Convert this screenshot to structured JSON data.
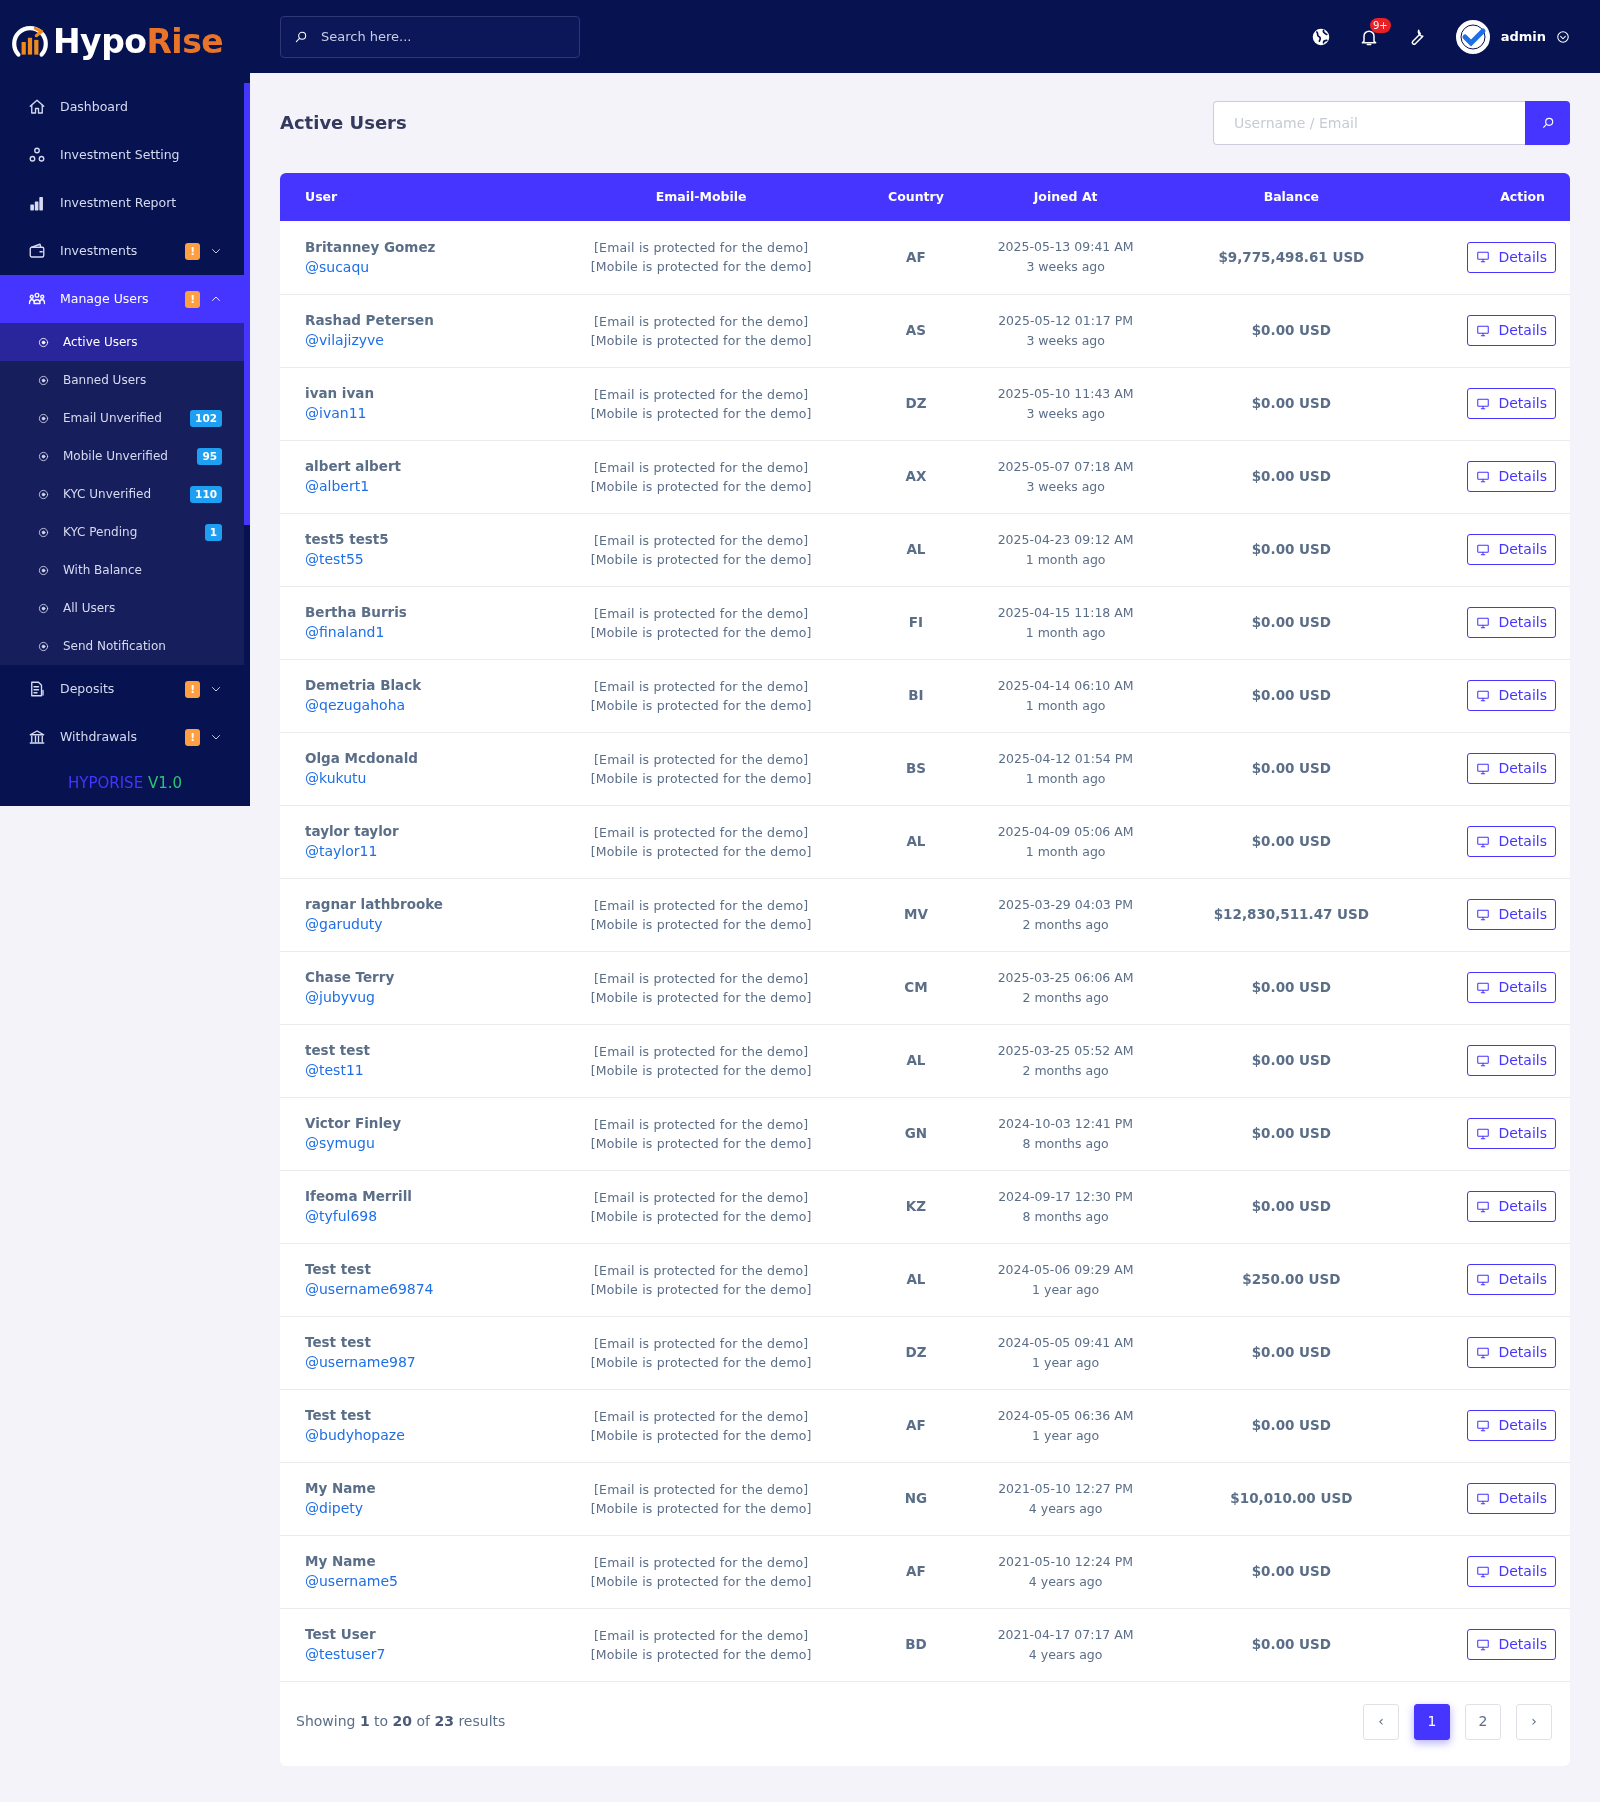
{
  "logo": {
    "part_1": "Hypo",
    "part_2": "Rise"
  },
  "sidebar": {
    "items": [
      {
        "label": "Dashboard",
        "selected": false
      },
      {
        "label": "Investment Setting",
        "selected": false
      },
      {
        "label": "Investment Report",
        "selected": false
      },
      {
        "label": "Investments",
        "selected": false,
        "expanded": false,
        "badge": {
          "text": "!",
          "color": "#ff9f43"
        }
      },
      {
        "label": "Manage Users",
        "selected": true,
        "expanded": true,
        "badge": {
          "text": "!",
          "color": "#ff9f43"
        },
        "children": [
          {
            "label": "Active Users",
            "selected": true
          },
          {
            "label": "Banned Users",
            "selected": false
          },
          {
            "label": "Email Unverified",
            "selected": false,
            "badge": {
              "text": "102",
              "color": "#1e9ff2"
            }
          },
          {
            "label": "Mobile Unverified",
            "selected": false,
            "badge": {
              "text": "95",
              "color": "#1e9ff2"
            }
          },
          {
            "label": "KYC Unverified",
            "selected": false,
            "badge": {
              "text": "110",
              "color": "#1e9ff2"
            }
          },
          {
            "label": "KYC Pending",
            "selected": false,
            "badge": {
              "text": "1",
              "color": "#1e9ff2"
            }
          },
          {
            "label": "With Balance",
            "selected": false
          },
          {
            "label": "All Users",
            "selected": false
          },
          {
            "label": "Send Notification",
            "selected": false
          }
        ]
      },
      {
        "label": "Deposits",
        "selected": false,
        "expanded": false,
        "badge": {
          "text": "!",
          "color": "#ff9f43"
        }
      },
      {
        "label": "Withdrawals",
        "selected": false,
        "expanded": false,
        "badge": {
          "text": "!",
          "color": "#ff9f43"
        }
      }
    ],
    "version": {
      "name": "HYPORISE",
      "number": "V1.0"
    }
  },
  "header": {
    "search": {
      "placeholder": "Search here..."
    },
    "notification_count": "9+",
    "user": "admin"
  },
  "page": {
    "title": "Active Users",
    "search": {
      "placeholder": "Username / Email"
    }
  },
  "table": {
    "columns": [
      "User",
      "Email-Mobile",
      "Country",
      "Joined At",
      "Balance",
      "Action"
    ],
    "rows": [
      {
        "name": "Britanney Gomez",
        "username": "@sucaqu",
        "email": "[Email is protected for the demo]",
        "mobile": "[Mobile is protected for the demo]",
        "country": "AF",
        "joined": "2025-05-13 09:41 AM",
        "joined_ago": "3 weeks ago",
        "balance": "$9,775,498.61 USD",
        "action": "Details"
      },
      {
        "name": "Rashad Petersen",
        "username": "@vilajizyve",
        "email": "[Email is protected for the demo]",
        "mobile": "[Mobile is protected for the demo]",
        "country": "AS",
        "joined": "2025-05-12 01:17 PM",
        "joined_ago": "3 weeks ago",
        "balance": "$0.00 USD",
        "action": "Details"
      },
      {
        "name": "ivan ivan",
        "username": "@ivan11",
        "email": "[Email is protected for the demo]",
        "mobile": "[Mobile is protected for the demo]",
        "country": "DZ",
        "joined": "2025-05-10 11:43 AM",
        "joined_ago": "3 weeks ago",
        "balance": "$0.00 USD",
        "action": "Details"
      },
      {
        "name": "albert albert",
        "username": "@albert1",
        "email": "[Email is protected for the demo]",
        "mobile": "[Mobile is protected for the demo]",
        "country": "AX",
        "joined": "2025-05-07 07:18 AM",
        "joined_ago": "3 weeks ago",
        "balance": "$0.00 USD",
        "action": "Details"
      },
      {
        "name": "test5 test5",
        "username": "@test55",
        "email": "[Email is protected for the demo]",
        "mobile": "[Mobile is protected for the demo]",
        "country": "AL",
        "joined": "2025-04-23 09:12 AM",
        "joined_ago": "1 month ago",
        "balance": "$0.00 USD",
        "action": "Details"
      },
      {
        "name": "Bertha Burris",
        "username": "@finaland1",
        "email": "[Email is protected for the demo]",
        "mobile": "[Mobile is protected for the demo]",
        "country": "FI",
        "joined": "2025-04-15 11:18 AM",
        "joined_ago": "1 month ago",
        "balance": "$0.00 USD",
        "action": "Details"
      },
      {
        "name": "Demetria Black",
        "username": "@qezugahoha",
        "email": "[Email is protected for the demo]",
        "mobile": "[Mobile is protected for the demo]",
        "country": "BI",
        "joined": "2025-04-14 06:10 AM",
        "joined_ago": "1 month ago",
        "balance": "$0.00 USD",
        "action": "Details"
      },
      {
        "name": "Olga Mcdonald",
        "username": "@kukutu",
        "email": "[Email is protected for the demo]",
        "mobile": "[Mobile is protected for the demo]",
        "country": "BS",
        "joined": "2025-04-12 01:54 PM",
        "joined_ago": "1 month ago",
        "balance": "$0.00 USD",
        "action": "Details"
      },
      {
        "name": "taylor taylor",
        "username": "@taylor11",
        "email": "[Email is protected for the demo]",
        "mobile": "[Mobile is protected for the demo]",
        "country": "AL",
        "joined": "2025-04-09 05:06 AM",
        "joined_ago": "1 month ago",
        "balance": "$0.00 USD",
        "action": "Details"
      },
      {
        "name": "ragnar lathbrooke",
        "username": "@garuduty",
        "email": "[Email is protected for the demo]",
        "mobile": "[Mobile is protected for the demo]",
        "country": "MV",
        "joined": "2025-03-29 04:03 PM",
        "joined_ago": "2 months ago",
        "balance": "$12,830,511.47 USD",
        "action": "Details"
      },
      {
        "name": "Chase Terry",
        "username": "@jubyvug",
        "email": "[Email is protected for the demo]",
        "mobile": "[Mobile is protected for the demo]",
        "country": "CM",
        "joined": "2025-03-25 06:06 AM",
        "joined_ago": "2 months ago",
        "balance": "$0.00 USD",
        "action": "Details"
      },
      {
        "name": "test test",
        "username": "@test11",
        "email": "[Email is protected for the demo]",
        "mobile": "[Mobile is protected for the demo]",
        "country": "AL",
        "joined": "2025-03-25 05:52 AM",
        "joined_ago": "2 months ago",
        "balance": "$0.00 USD",
        "action": "Details"
      },
      {
        "name": "Victor Finley",
        "username": "@symugu",
        "email": "[Email is protected for the demo]",
        "mobile": "[Mobile is protected for the demo]",
        "country": "GN",
        "joined": "2024-10-03 12:41 PM",
        "joined_ago": "8 months ago",
        "balance": "$0.00 USD",
        "action": "Details"
      },
      {
        "name": "Ifeoma Merrill",
        "username": "@tyful698",
        "email": "[Email is protected for the demo]",
        "mobile": "[Mobile is protected for the demo]",
        "country": "KZ",
        "joined": "2024-09-17 12:30 PM",
        "joined_ago": "8 months ago",
        "balance": "$0.00 USD",
        "action": "Details"
      },
      {
        "name": "Test test",
        "username": "@username69874",
        "email": "[Email is protected for the demo]",
        "mobile": "[Mobile is protected for the demo]",
        "country": "AL",
        "joined": "2024-05-06 09:29 AM",
        "joined_ago": "1 year ago",
        "balance": "$250.00 USD",
        "action": "Details"
      },
      {
        "name": "Test test",
        "username": "@username987",
        "email": "[Email is protected for the demo]",
        "mobile": "[Mobile is protected for the demo]",
        "country": "DZ",
        "joined": "2024-05-05 09:41 AM",
        "joined_ago": "1 year ago",
        "balance": "$0.00 USD",
        "action": "Details"
      },
      {
        "name": "Test test",
        "username": "@budyhopaze",
        "email": "[Email is protected for the demo]",
        "mobile": "[Mobile is protected for the demo]",
        "country": "AF",
        "joined": "2024-05-05 06:36 AM",
        "joined_ago": "1 year ago",
        "balance": "$0.00 USD",
        "action": "Details"
      },
      {
        "name": "My Name",
        "username": "@dipety",
        "email": "[Email is protected for the demo]",
        "mobile": "[Mobile is protected for the demo]",
        "country": "NG",
        "joined": "2021-05-10 12:27 PM",
        "joined_ago": "4 years ago",
        "balance": "$10,010.00 USD",
        "action": "Details"
      },
      {
        "name": "My Name",
        "username": "@username5",
        "email": "[Email is protected for the demo]",
        "mobile": "[Mobile is protected for the demo]",
        "country": "AF",
        "joined": "2021-05-10 12:24 PM",
        "joined_ago": "4 years ago",
        "balance": "$0.00 USD",
        "action": "Details"
      },
      {
        "name": "Test User",
        "username": "@testuser7",
        "email": "[Email is protected for the demo]",
        "mobile": "[Mobile is protected for the demo]",
        "country": "BD",
        "joined": "2021-04-17 07:17 AM",
        "joined_ago": "4 years ago",
        "balance": "$0.00 USD",
        "action": "Details"
      }
    ]
  },
  "pagination": {
    "summary": "Showing **1** to **20** of **23** results",
    "prev": "‹",
    "pages": [
      {
        "label": "1",
        "selected": true
      },
      {
        "label": "2",
        "selected": false
      }
    ],
    "next": "›"
  }
}
